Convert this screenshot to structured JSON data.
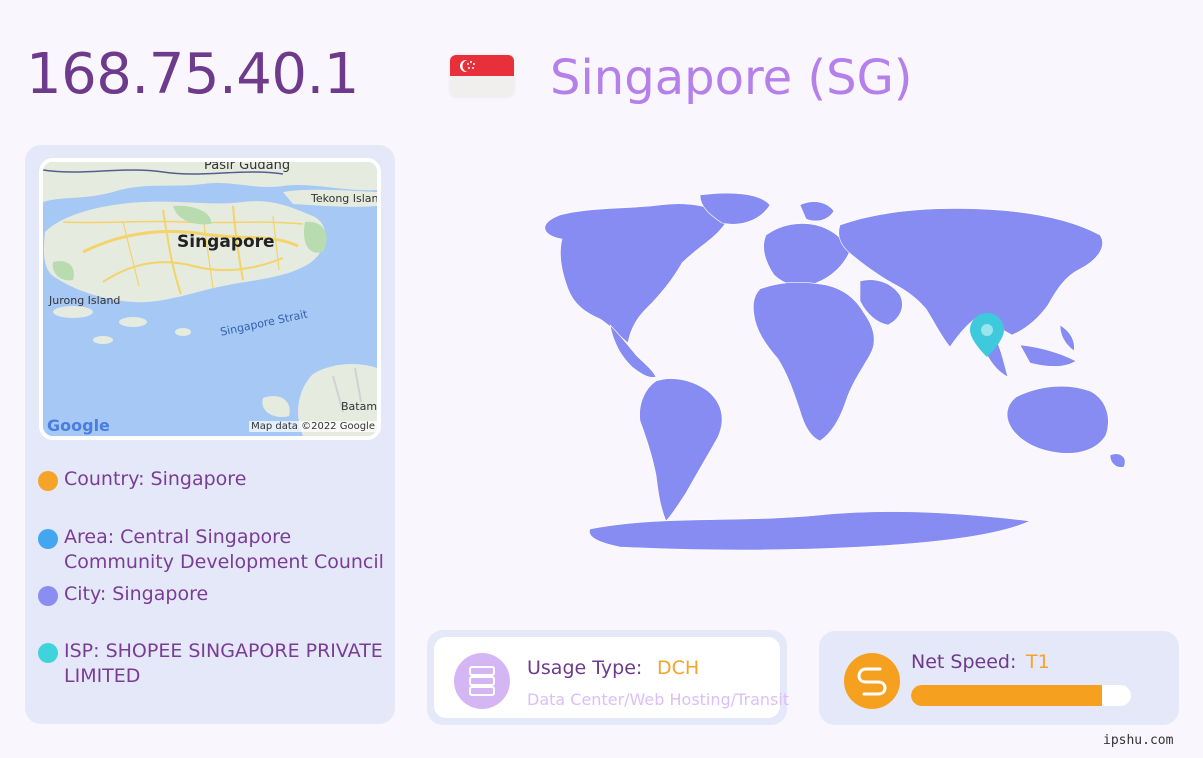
{
  "header": {
    "ip": "168.75.40.1",
    "country_title": "Singapore (SG)",
    "flag_icon": "singapore-flag-icon"
  },
  "map": {
    "labels": {
      "pasir_gudang": "Pasir Gudang",
      "tekong": "Tekong Islan",
      "city": "Singapore",
      "jurong": "Jurong Island",
      "strait": "Singapore Strait",
      "batam": "Batam"
    },
    "logo": "Google",
    "attribution": "Map data ©2022 Google"
  },
  "info": {
    "country": "Country: Singapore",
    "area": "Area: Central Singapore Community Development Council",
    "city": "City: Singapore",
    "isp": "ISP: SHOPEE SINGAPORE PRIVATE LIMITED"
  },
  "colors": {
    "country_dot": "#f5a329",
    "area_dot": "#42a7f0",
    "city_dot": "#8a8ef0",
    "isp_dot": "#3fd4dc",
    "world_land": "#868cf1",
    "marker": "#3fc9dd"
  },
  "usage": {
    "label": "Usage Type:",
    "value": "DCH",
    "description": "Data Center/Web Hosting/Transit",
    "icon": "server-icon"
  },
  "speed": {
    "label": "Net Speed:",
    "value": "T1",
    "fill_fraction": 0.87,
    "icon": "speed-icon"
  },
  "watermark": "ipshu.com"
}
